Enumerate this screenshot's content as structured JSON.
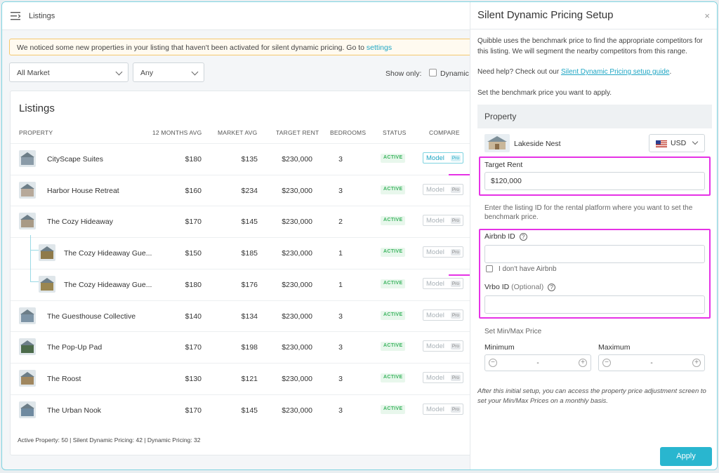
{
  "topbar": {
    "title": "Listings"
  },
  "notice": {
    "text": "We noticed some new properties in your listing that haven't been activated for silent dynamic pricing. Go to ",
    "link": "settings"
  },
  "filters": {
    "market": "All Market",
    "any": "Any",
    "show_only": "Show only:",
    "dynamic_label": "Dynamic P"
  },
  "listings": {
    "title": "Listings",
    "columns": [
      "PROPERTY",
      "12 MONTHS AVG",
      "MARKET AVG",
      "TARGET RENT",
      "BEDROOMS",
      "STATUS",
      "COMPARE"
    ],
    "rows": [
      {
        "name": "CityScape Suites",
        "avg12": "$180",
        "market": "$135",
        "target": "$230,000",
        "beds": "3",
        "status": "ACTIVE",
        "compare": "Model",
        "pro": "Pro",
        "child": false,
        "model_active": true,
        "thumb_color": "#8a9ba8"
      },
      {
        "name": "Harbor House Retreat",
        "avg12": "$160",
        "market": "$234",
        "target": "$230,000",
        "beds": "3",
        "status": "ACTIVE",
        "compare": "Model",
        "pro": "Pro",
        "child": false,
        "model_active": false,
        "thumb_color": "#b7a99a"
      },
      {
        "name": "The Cozy Hideaway",
        "avg12": "$170",
        "market": "$145",
        "target": "$230,000",
        "beds": "2",
        "status": "ACTIVE",
        "compare": "Model",
        "pro": "Pro",
        "child": false,
        "model_active": false,
        "thumb_color": "#a89a86"
      },
      {
        "name": "The Cozy Hideaway Gue...",
        "avg12": "$150",
        "market": "$185",
        "target": "$230,000",
        "beds": "1",
        "status": "ACTIVE",
        "compare": "Model",
        "pro": "Pro",
        "child": true,
        "model_active": false,
        "thumb_color": "#8f7a4a"
      },
      {
        "name": "The Cozy Hideaway Gue...",
        "avg12": "$180",
        "market": "$176",
        "target": "$230,000",
        "beds": "1",
        "status": "ACTIVE",
        "compare": "Model",
        "pro": "Pro",
        "child": true,
        "model_active": false,
        "thumb_color": "#9a8650"
      },
      {
        "name": "The Guesthouse Collective",
        "avg12": "$140",
        "market": "$134",
        "target": "$230,000",
        "beds": "3",
        "status": "ACTIVE",
        "compare": "Model",
        "pro": "Pro",
        "child": false,
        "model_active": false,
        "thumb_color": "#7d94a6"
      },
      {
        "name": "The Pop-Up Pad",
        "avg12": "$170",
        "market": "$198",
        "target": "$230,000",
        "beds": "3",
        "status": "ACTIVE",
        "compare": "Model",
        "pro": "Pro",
        "child": false,
        "model_active": false,
        "thumb_color": "#4c6b4a"
      },
      {
        "name": "The Roost",
        "avg12": "$130",
        "market": "$121",
        "target": "$230,000",
        "beds": "3",
        "status": "ACTIVE",
        "compare": "Model",
        "pro": "Pro",
        "child": false,
        "model_active": false,
        "thumb_color": "#a0875f"
      },
      {
        "name": "The Urban Nook",
        "avg12": "$170",
        "market": "$145",
        "target": "$230,000",
        "beds": "3",
        "status": "ACTIVE",
        "compare": "Model",
        "pro": "Pro",
        "child": false,
        "model_active": false,
        "thumb_color": "#6f8aa0"
      }
    ],
    "footer": "Active Property: 50 | Silent Dynamic Pricing: 42 | Dynamic Pricing: 32"
  },
  "panel": {
    "title": "Silent Dynamic Pricing Setup",
    "close": "×",
    "intro": "Quibble uses the benchmark price to find the appropriate competitors for this listing.  We will segment the nearby competitors from this range.",
    "help_prefix": "Need help? Check out our ",
    "help_link": "Silent Dynamic Pricing setup guide",
    "help_suffix": ".",
    "set_benchmark": "Set the benchmark price you want to apply.",
    "property_header": "Property",
    "property_name": "Lakeside Nest",
    "currency": "USD",
    "target_rent_label": "Target Rent",
    "target_rent_value": "$120,000",
    "listing_id_note": "Enter the listing ID for the rental platform where you want to set the benchmark price.",
    "airbnb_label": "Airbnb ID",
    "airbnb_value": "",
    "no_airbnb": "I don't have Airbnb",
    "vrbo_label": "Vrbo ID",
    "vrbo_optional": "(Optional)",
    "vrbo_value": "",
    "minmax_label": "Set Min/Max Price",
    "minimum_label": "Minimum",
    "maximum_label": "Maximum",
    "min_value": "-",
    "max_value": "-",
    "note": "After this initial setup, you can access the property price adjustment screen to set  your Min/Max Prices on a monthly basis.",
    "apply": "Apply"
  },
  "colors": {
    "accent": "#29b6cf",
    "highlight": "#e632e6",
    "active_status": "#3bb45f"
  }
}
